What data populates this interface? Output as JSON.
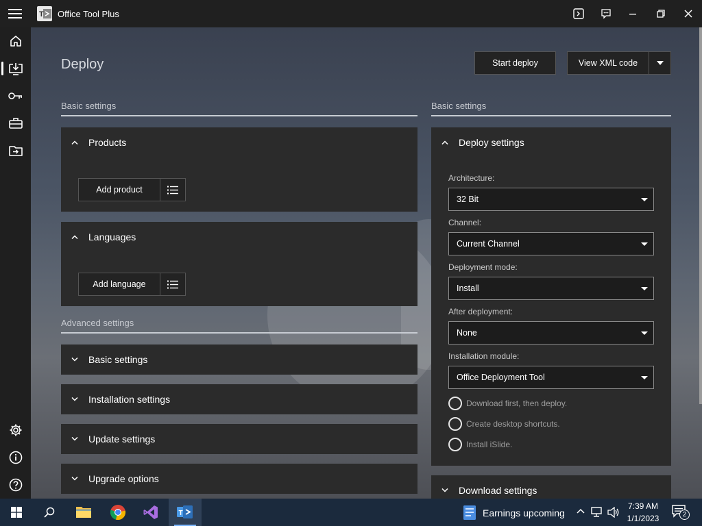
{
  "window": {
    "title": "Office Tool Plus"
  },
  "page": {
    "title": "Deploy"
  },
  "actions": {
    "start_deploy": "Start deploy",
    "view_xml": "View XML code"
  },
  "left": {
    "basic_header": "Basic settings",
    "products": {
      "title": "Products",
      "add_button": "Add product"
    },
    "languages": {
      "title": "Languages",
      "add_button": "Add language"
    },
    "advanced_header": "Advanced settings",
    "collapsed": [
      "Basic settings",
      "Installation settings",
      "Update settings",
      "Upgrade options"
    ]
  },
  "right": {
    "basic_header": "Basic settings",
    "deploy_settings": {
      "title": "Deploy settings",
      "architecture": {
        "label": "Architecture:",
        "value": "32 Bit"
      },
      "channel": {
        "label": "Channel:",
        "value": "Current Channel"
      },
      "mode": {
        "label": "Deployment mode:",
        "value": "Install"
      },
      "after": {
        "label": "After deployment:",
        "value": "None"
      },
      "module": {
        "label": "Installation module:",
        "value": "Office Deployment Tool"
      },
      "options": [
        "Download first, then deploy.",
        "Create desktop shortcuts.",
        "Install iSlide."
      ]
    },
    "download_settings": {
      "title": "Download settings"
    }
  },
  "taskbar": {
    "news": "Earnings upcoming",
    "time": "7:39 AM",
    "date": "1/1/2023",
    "notification_count": "2"
  },
  "colors": {
    "accent": "#7cb6ff",
    "taskbar": "#1b2a3d",
    "card": "#2b2b2b"
  },
  "icons": [
    "hamburger-icon",
    "home-icon",
    "deploy-icon",
    "key-icon",
    "toolbox-icon",
    "folder-import-icon",
    "settings-gear-icon",
    "info-icon",
    "help-icon"
  ]
}
